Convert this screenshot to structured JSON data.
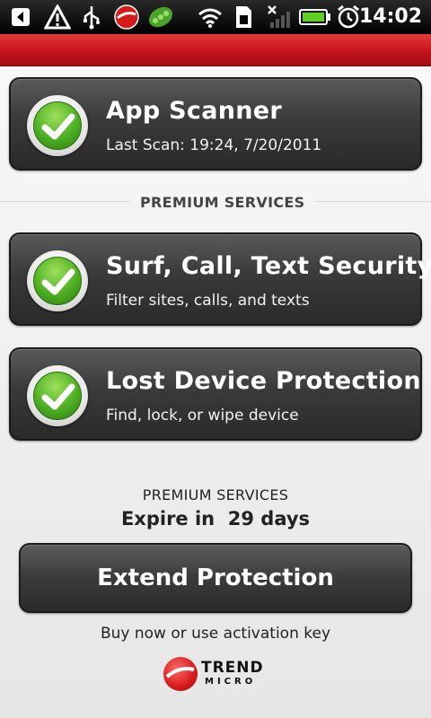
{
  "status_bar": {
    "time": "14:02",
    "icons": [
      "back-notification-icon",
      "warning-icon",
      "usb-icon",
      "trend-micro-icon",
      "peas-app-icon",
      "wifi-icon",
      "sim-card-icon",
      "no-signal-icon",
      "battery-icon",
      "alarm-clock-icon"
    ]
  },
  "cards": [
    {
      "title": "App Scanner",
      "subtitle": "Last Scan: 19:24, 7/20/2011",
      "icon": "green-check-icon"
    },
    {
      "title": "Surf, Call, Text Security",
      "subtitle": "Filter sites, calls, and texts",
      "icon": "green-check-icon"
    },
    {
      "title": "Lost Device Protection",
      "subtitle": "Find, lock, or wipe device",
      "icon": "green-check-icon"
    }
  ],
  "premium_section_heading": "PREMIUM SERVICES",
  "expiry": {
    "label": "PREMIUM SERVICES",
    "text": "Expire in  29 days"
  },
  "extend_button": "Extend Protection",
  "buy_text": "Buy now or use activation key",
  "logo": {
    "line1": "TREND",
    "line2": "MICRO"
  },
  "colors": {
    "header_red": "#c4141b",
    "card_dark": "#3a3a3a",
    "check_green": "#4cae22"
  }
}
